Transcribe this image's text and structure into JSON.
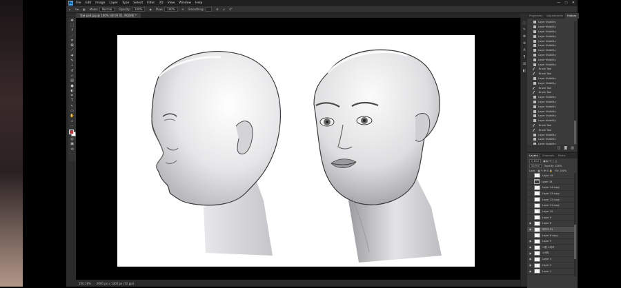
{
  "app": {
    "logo": "Ps",
    "menu": [
      "File",
      "Edit",
      "Image",
      "Layer",
      "Type",
      "Select",
      "Filter",
      "3D",
      "View",
      "Window",
      "Help"
    ],
    "window_controls": [
      "—",
      "▭",
      "✕"
    ]
  },
  "options_bar": {
    "mode_label": "Mode:",
    "mode_value": "Normal",
    "opacity_label": "Opacity:",
    "opacity_value": "100%",
    "flow_label": "Flow:",
    "flow_value": "100%",
    "smoothing_label": "Smoothing:",
    "angle_value": "0°"
  },
  "document": {
    "tab_title": "얼굴 pad.jpg @ 100% (레이어 01, RGB/8) *"
  },
  "status": {
    "zoom": "100.18%",
    "doc_size": "2000 px x 1300 px (72 ppi)"
  },
  "history_panel": {
    "tabs": [
      "Properties",
      "Adjustments",
      "History"
    ],
    "active_tab": "History",
    "items": [
      {
        "label": "Layer Visibility",
        "icon": "layer"
      },
      {
        "label": "Layer Visibility",
        "icon": "layer"
      },
      {
        "label": "Layer Visibility",
        "icon": "layer"
      },
      {
        "label": "Layer Visibility",
        "icon": "layer"
      },
      {
        "label": "Layer Visibility",
        "icon": "layer"
      },
      {
        "label": "Layer Visibility",
        "icon": "layer"
      },
      {
        "label": "Layer Visibility",
        "icon": "layer"
      },
      {
        "label": "Layer Visibility",
        "icon": "layer"
      },
      {
        "label": "Layer Visibility",
        "icon": "layer"
      },
      {
        "label": "Layer Visibility",
        "icon": "layer"
      },
      {
        "label": "Brush Tool",
        "icon": "brush"
      },
      {
        "label": "Brush Tool",
        "icon": "brush"
      },
      {
        "label": "Layer Visibility",
        "icon": "layer"
      },
      {
        "label": "Layer Visibility",
        "icon": "layer"
      },
      {
        "label": "Brush Tool",
        "icon": "brush"
      },
      {
        "label": "Brush Tool",
        "icon": "brush"
      },
      {
        "label": "Layer Visibility",
        "icon": "layer"
      },
      {
        "label": "Layer Visibility",
        "icon": "layer"
      },
      {
        "label": "Layer Visibility",
        "icon": "layer"
      },
      {
        "label": "Layer Visibility",
        "icon": "layer"
      },
      {
        "label": "Layer Visibility",
        "icon": "layer"
      },
      {
        "label": "Layer Visibility",
        "icon": "layer"
      },
      {
        "label": "Brush Tool",
        "icon": "brush"
      },
      {
        "label": "Brush Tool",
        "icon": "brush"
      },
      {
        "label": "Layer Visibility",
        "icon": "layer"
      },
      {
        "label": "Layer Visibility",
        "icon": "layer"
      },
      {
        "label": "Layer Visibility",
        "icon": "layer"
      },
      {
        "label": "Layer Visibility",
        "icon": "layer"
      }
    ]
  },
  "layers_panel": {
    "tabs": [
      "Layers",
      "Channels",
      "Paths"
    ],
    "active_tab": "Layers",
    "kind_filter": "Q Kind",
    "blend_mode": "Normal",
    "opacity": "Opacity: 100%",
    "lock_label": "Lock:",
    "fill": "Fill: 100%",
    "layers": [
      {
        "name": "Layer 19",
        "type": "layer",
        "visible": false
      },
      {
        "name": "Layer 18",
        "type": "folder",
        "visible": false
      },
      {
        "name": "Layer 14 copy",
        "type": "layer",
        "visible": false
      },
      {
        "name": "Layer 13 copy",
        "type": "layer",
        "visible": false
      },
      {
        "name": "Layer 12 copy",
        "type": "layer",
        "visible": false
      },
      {
        "name": "Layer 11 copy",
        "type": "layer",
        "visible": false
      },
      {
        "name": "Layer 10",
        "type": "layer",
        "visible": false
      },
      {
        "name": "Layer 9",
        "type": "layer",
        "visible": false
      },
      {
        "name": "Layer 8",
        "type": "layer",
        "visible": true
      },
      {
        "name": "레이어 01",
        "type": "layer",
        "visible": true,
        "selected": true
      },
      {
        "name": "Layer 6 copy",
        "type": "layer",
        "visible": false
      },
      {
        "name": "Layer 5",
        "type": "layer",
        "visible": true
      },
      {
        "name": "그룹 스케치",
        "type": "layer",
        "visible": true
      },
      {
        "name": "스케치",
        "type": "layer",
        "visible": true
      },
      {
        "name": "Layer 3",
        "type": "layer",
        "visible": true
      },
      {
        "name": "Layer 2",
        "type": "layer",
        "visible": true
      },
      {
        "name": "Layer 1",
        "type": "layer",
        "visible": true
      }
    ]
  },
  "colors": {
    "foreground": "#c83232",
    "background": "#ffffff",
    "accent": "#31a8ff"
  }
}
